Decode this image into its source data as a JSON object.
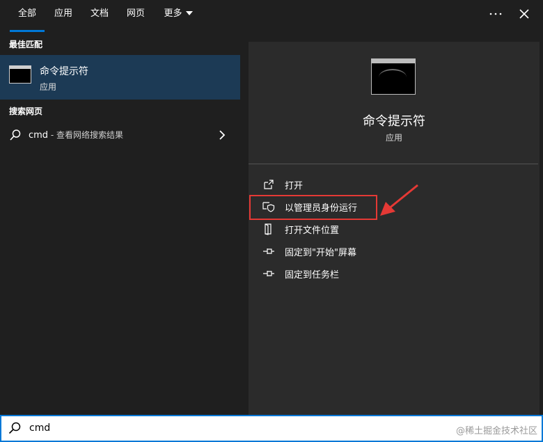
{
  "tabs": [
    {
      "label": "全部",
      "active": true
    },
    {
      "label": "应用"
    },
    {
      "label": "文档"
    },
    {
      "label": "网页"
    },
    {
      "label": "更多"
    }
  ],
  "top_icons": [
    "more-dots-icon",
    "close-icon"
  ],
  "sections": {
    "best_match": "最佳匹配",
    "web_search": "搜索网页"
  },
  "best_match": {
    "name": "命令提示符",
    "type": "应用",
    "icon": "cmd-app-icon"
  },
  "web_result": {
    "query": "cmd",
    "suffix": " - 查看网络搜索结果",
    "icon": "search-icon"
  },
  "detail": {
    "name": "命令提示符",
    "type": "应用"
  },
  "actions": [
    {
      "label": "打开",
      "icon": "open-icon"
    },
    {
      "label": "以管理员身份运行",
      "icon": "admin-shield-icon"
    },
    {
      "label": "打开文件位置",
      "icon": "file-location-icon"
    },
    {
      "label": "固定到\"开始\"屏幕",
      "icon": "pin-icon"
    },
    {
      "label": "固定到任务栏",
      "icon": "pin-icon"
    }
  ],
  "search": {
    "value": "cmd"
  },
  "watermark": "@稀土掘金技术社区",
  "colors": {
    "accent": "#0078d7",
    "selected_bg": "#1c3a55",
    "annotation": "#e53935"
  }
}
